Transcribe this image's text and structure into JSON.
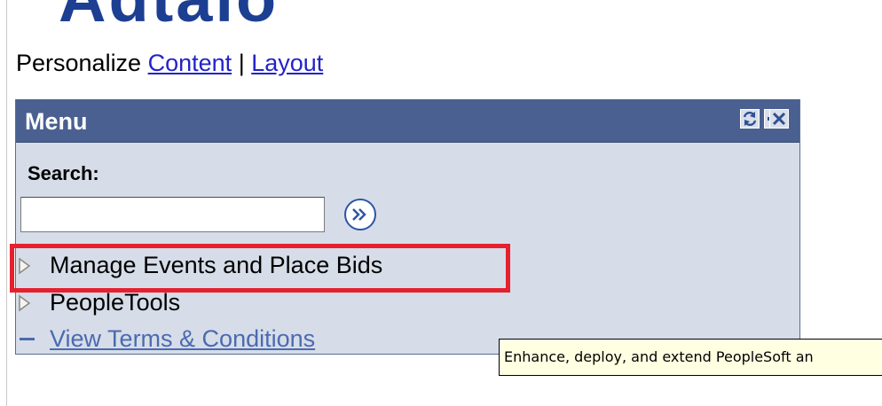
{
  "header": {
    "logo_text": "Adtalo"
  },
  "personalize": {
    "prefix": "Personalize",
    "content_link": "Content",
    "separator": "|",
    "layout_link": "Layout"
  },
  "menu": {
    "title": "Menu",
    "header_buttons": [
      "refresh-icon",
      "minimize-icon",
      "close-icon"
    ],
    "search_label": "Search:",
    "search_value": "",
    "go_icon": "double-chevron-right-icon",
    "items": [
      {
        "label": "Manage Events and Place Bids",
        "icon": "expand-triangle-icon",
        "type": "folder"
      },
      {
        "label": "PeopleTools",
        "icon": "expand-triangle-icon",
        "type": "folder"
      },
      {
        "label": "View Terms & Conditions",
        "icon": "dash-icon",
        "type": "link"
      }
    ]
  },
  "tooltip": {
    "text": "Enhance, deploy, and extend PeopleSoft an"
  },
  "colors": {
    "panel_header": "#4a6090",
    "panel_body": "#d6dde8",
    "link": "#2323c8",
    "highlight": "#e5202f",
    "tooltip_bg": "#ffffe1"
  }
}
